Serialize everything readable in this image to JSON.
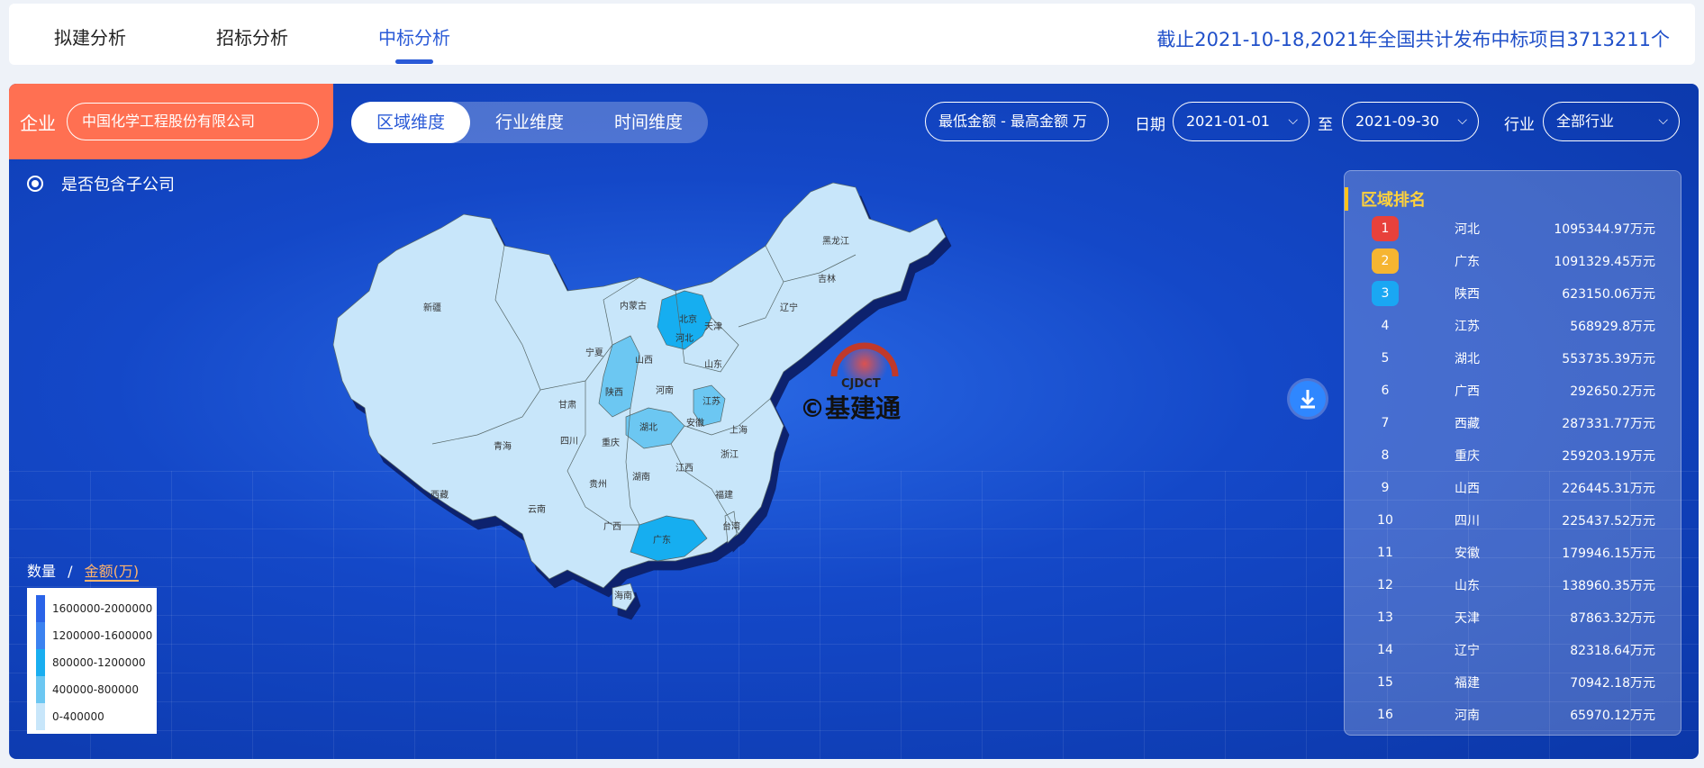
{
  "tabs": [
    {
      "label": "拟建分析",
      "active": false
    },
    {
      "label": "招标分析",
      "active": false
    },
    {
      "label": "中标分析",
      "active": true
    }
  ],
  "banner": "截止2021-10-18,2021年全国共计发布中标项目3713211个",
  "filters": {
    "company_label": "企业",
    "company_value": "中国化学工程股份有限公司",
    "dimensions": [
      "区域维度",
      "行业维度",
      "时间维度"
    ],
    "active_dimension": "区域维度",
    "amount_range": "最低金额  - 最高金额  万",
    "date_label": "日期",
    "date_from": "2021-01-01",
    "to_label": "至",
    "date_to": "2021-09-30",
    "industry_label": "行业",
    "industry_value": "全部行业",
    "include_subsidiaries": "是否包含子公司"
  },
  "legend": {
    "count_label": "数量",
    "separator": "/",
    "amount_label": "金额(万)",
    "ranges": [
      {
        "label": "1600000-2000000",
        "color": "#2a63e8"
      },
      {
        "label": "1200000-1600000",
        "color": "#3b82f0"
      },
      {
        "label": "800000-1200000",
        "color": "#19aef0"
      },
      {
        "label": "400000-800000",
        "color": "#6cc7f2"
      },
      {
        "label": "0-400000",
        "color": "#c8e6fa"
      }
    ]
  },
  "map": {
    "provinces": [
      "新疆",
      "西藏",
      "青海",
      "甘肃",
      "内蒙古",
      "黑龙江",
      "吉林",
      "辽宁",
      "北京",
      "天津",
      "河北",
      "山西",
      "山东",
      "宁夏",
      "陕西",
      "河南",
      "江苏",
      "安徽",
      "湖北",
      "四川",
      "重庆",
      "浙江",
      "上海",
      "江西",
      "湖南",
      "贵州",
      "云南",
      "福建",
      "广西",
      "广东",
      "海南",
      "台湾"
    ],
    "highlight_colors": {
      "base": "#c8e6fa",
      "mid": "#6cc7f2",
      "high": "#19aef0"
    }
  },
  "watermark": {
    "brand": "CJDCT",
    "text": "©基建通"
  },
  "ranking": {
    "title": "区域排名",
    "rows": [
      {
        "rank": "1",
        "name": "河北",
        "value": "1095344.97万元",
        "badge": "#e8413b"
      },
      {
        "rank": "2",
        "name": "广东",
        "value": "1091329.45万元",
        "badge": "#f6b531"
      },
      {
        "rank": "3",
        "name": "陕西",
        "value": "623150.06万元",
        "badge": "#1aa7f3"
      },
      {
        "rank": "4",
        "name": "江苏",
        "value": "568929.8万元",
        "badge": ""
      },
      {
        "rank": "5",
        "name": "湖北",
        "value": "553735.39万元",
        "badge": ""
      },
      {
        "rank": "6",
        "name": "广西",
        "value": "292650.2万元",
        "badge": ""
      },
      {
        "rank": "7",
        "name": "西藏",
        "value": "287331.77万元",
        "badge": ""
      },
      {
        "rank": "8",
        "name": "重庆",
        "value": "259203.19万元",
        "badge": ""
      },
      {
        "rank": "9",
        "name": "山西",
        "value": "226445.31万元",
        "badge": ""
      },
      {
        "rank": "10",
        "name": "四川",
        "value": "225437.52万元",
        "badge": ""
      },
      {
        "rank": "11",
        "name": "安徽",
        "value": "179946.15万元",
        "badge": ""
      },
      {
        "rank": "12",
        "name": "山东",
        "value": "138960.35万元",
        "badge": ""
      },
      {
        "rank": "13",
        "name": "天津",
        "value": "87863.32万元",
        "badge": ""
      },
      {
        "rank": "14",
        "name": "辽宁",
        "value": "82318.64万元",
        "badge": ""
      },
      {
        "rank": "15",
        "name": "福建",
        "value": "70942.18万元",
        "badge": ""
      },
      {
        "rank": "16",
        "name": "河南",
        "value": "65970.12万元",
        "badge": ""
      }
    ]
  }
}
